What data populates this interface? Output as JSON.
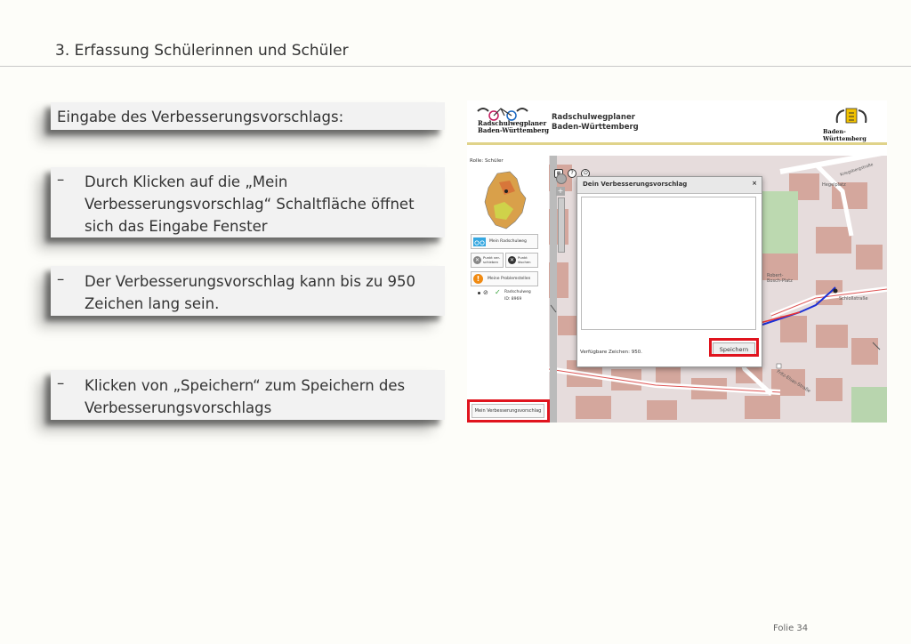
{
  "slide": {
    "title": "3. Erfassung Schülerinnen und Schüler",
    "footer": "Folie 34"
  },
  "boxes": [
    {
      "text": "Eingabe des Verbesserungsvorschlags:"
    },
    {
      "dash": "–",
      "lines": [
        "Durch Klicken auf die „Mein",
        "Verbesserungsvorschlag“ Schaltfläche öffnet",
        "sich das Eingabe Fenster"
      ]
    },
    {
      "dash": "–",
      "lines": [
        "Der Verbesserungsvorschlag kann bis zu 950",
        "Zeichen lang sein."
      ]
    },
    {
      "dash": "–",
      "lines": [
        "Klicken von „Speichern“ zum Speichern des",
        "Verbesserungsvorschlags"
      ]
    }
  ],
  "app": {
    "logo_line1": "Radschulwegplaner",
    "logo_line2": "Baden-Württemberg",
    "title_line1": "Radschulwegplaner",
    "title_line2": "Baden-Württemberg",
    "state_label": "Baden-Württemberg",
    "role": "Rolle: Schüler",
    "btn_mein_radschulweg": "Mein Radschulweg",
    "btn_punkt_verschieben": "Punkt ver-schieben",
    "btn_punkt_loeschen": "Punkt löschen",
    "btn_problemstellen": "Meine Problemstellen",
    "route_label": "Radschulweg",
    "route_id": "ID: 8969",
    "btn_verbesserungsvorschlag": "Mein Verbesserungsvorschlag",
    "map_labels": {
      "hegelplatz": "Hegelplatz",
      "kriegsbergstr": "Kriegsbergstraße",
      "robert_bosch_platz": "Robert-Bosch-Platz",
      "schlossstrasse": "Schloßstraße",
      "fritz_elsas": "Fritz-Elsas-Straße"
    },
    "dialog": {
      "title": "Dein Verbesserungsvorschlag",
      "close": "×",
      "textarea_value": "",
      "chars_label": "Verfügbare Zeichen: 950.",
      "save": "Speichern"
    }
  },
  "colors": {
    "highlight": "#e0141e",
    "route": "#1b2fd6",
    "header_rule": "#e0d38a"
  }
}
